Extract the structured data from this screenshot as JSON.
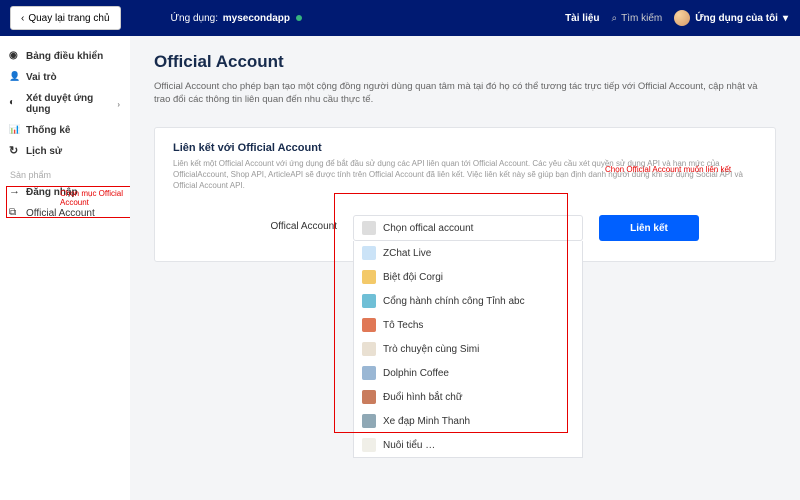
{
  "topbar": {
    "back": "Quay lại trang chủ",
    "app_prefix": "Ứng dụng:",
    "app_name": "mysecondapp",
    "docs": "Tài liệu",
    "search_placeholder": "Tìm kiếm",
    "my_apps": "Ứng dụng của tôi"
  },
  "sidebar": {
    "items": [
      {
        "label": "Bảng điều khiển"
      },
      {
        "label": "Vai trò"
      },
      {
        "label": "Xét duyệt ứng dụng"
      },
      {
        "label": "Thống kê"
      },
      {
        "label": "Lịch sử"
      }
    ],
    "group_label": "Sản phẩm",
    "products": [
      {
        "label": "Đăng nhập"
      },
      {
        "label": "Official Account"
      }
    ]
  },
  "annotations": {
    "sidebar": "Chọn mục Official Account",
    "dropdown": "Chọn Official Account muốn liên kết"
  },
  "main": {
    "title": "Official Account",
    "desc": "Official Account cho phép bạn tạo một cộng đồng người dùng quan tâm mà tại đó họ có thể tương tác trực tiếp với Official Account, cập nhật và trao đổi các thông tin liên quan đến nhu cầu thực tế."
  },
  "panel": {
    "title": "Liên kết với Official Account",
    "desc": "Liên kết một Official Account với ứng dụng để bắt đầu sử dụng các API liên quan tới Official Account. Các yêu cầu xét quyền sử dụng API và hạn mức của OfficialAccount, Shop API, ArticleAPI sẽ được tính trên Official Account đã liên kết. Việc liên kết này sẽ giúp bạn định danh người dùng khi sử dụng Social API và Official Account API.",
    "field_label": "Offical Account",
    "selected": "Chọn offical account",
    "options": [
      "ZChat Live",
      "Biệt đội Corgi",
      "Cổng hành chính công Tỉnh abc",
      "Tô Techs",
      "Trò chuyện cùng Simi",
      "Dolphin Coffee",
      "Đuổi hình bắt chữ",
      "Xe đạp Minh Thanh",
      "Nuôi tiểu …"
    ],
    "link_btn": "Liên kết"
  }
}
